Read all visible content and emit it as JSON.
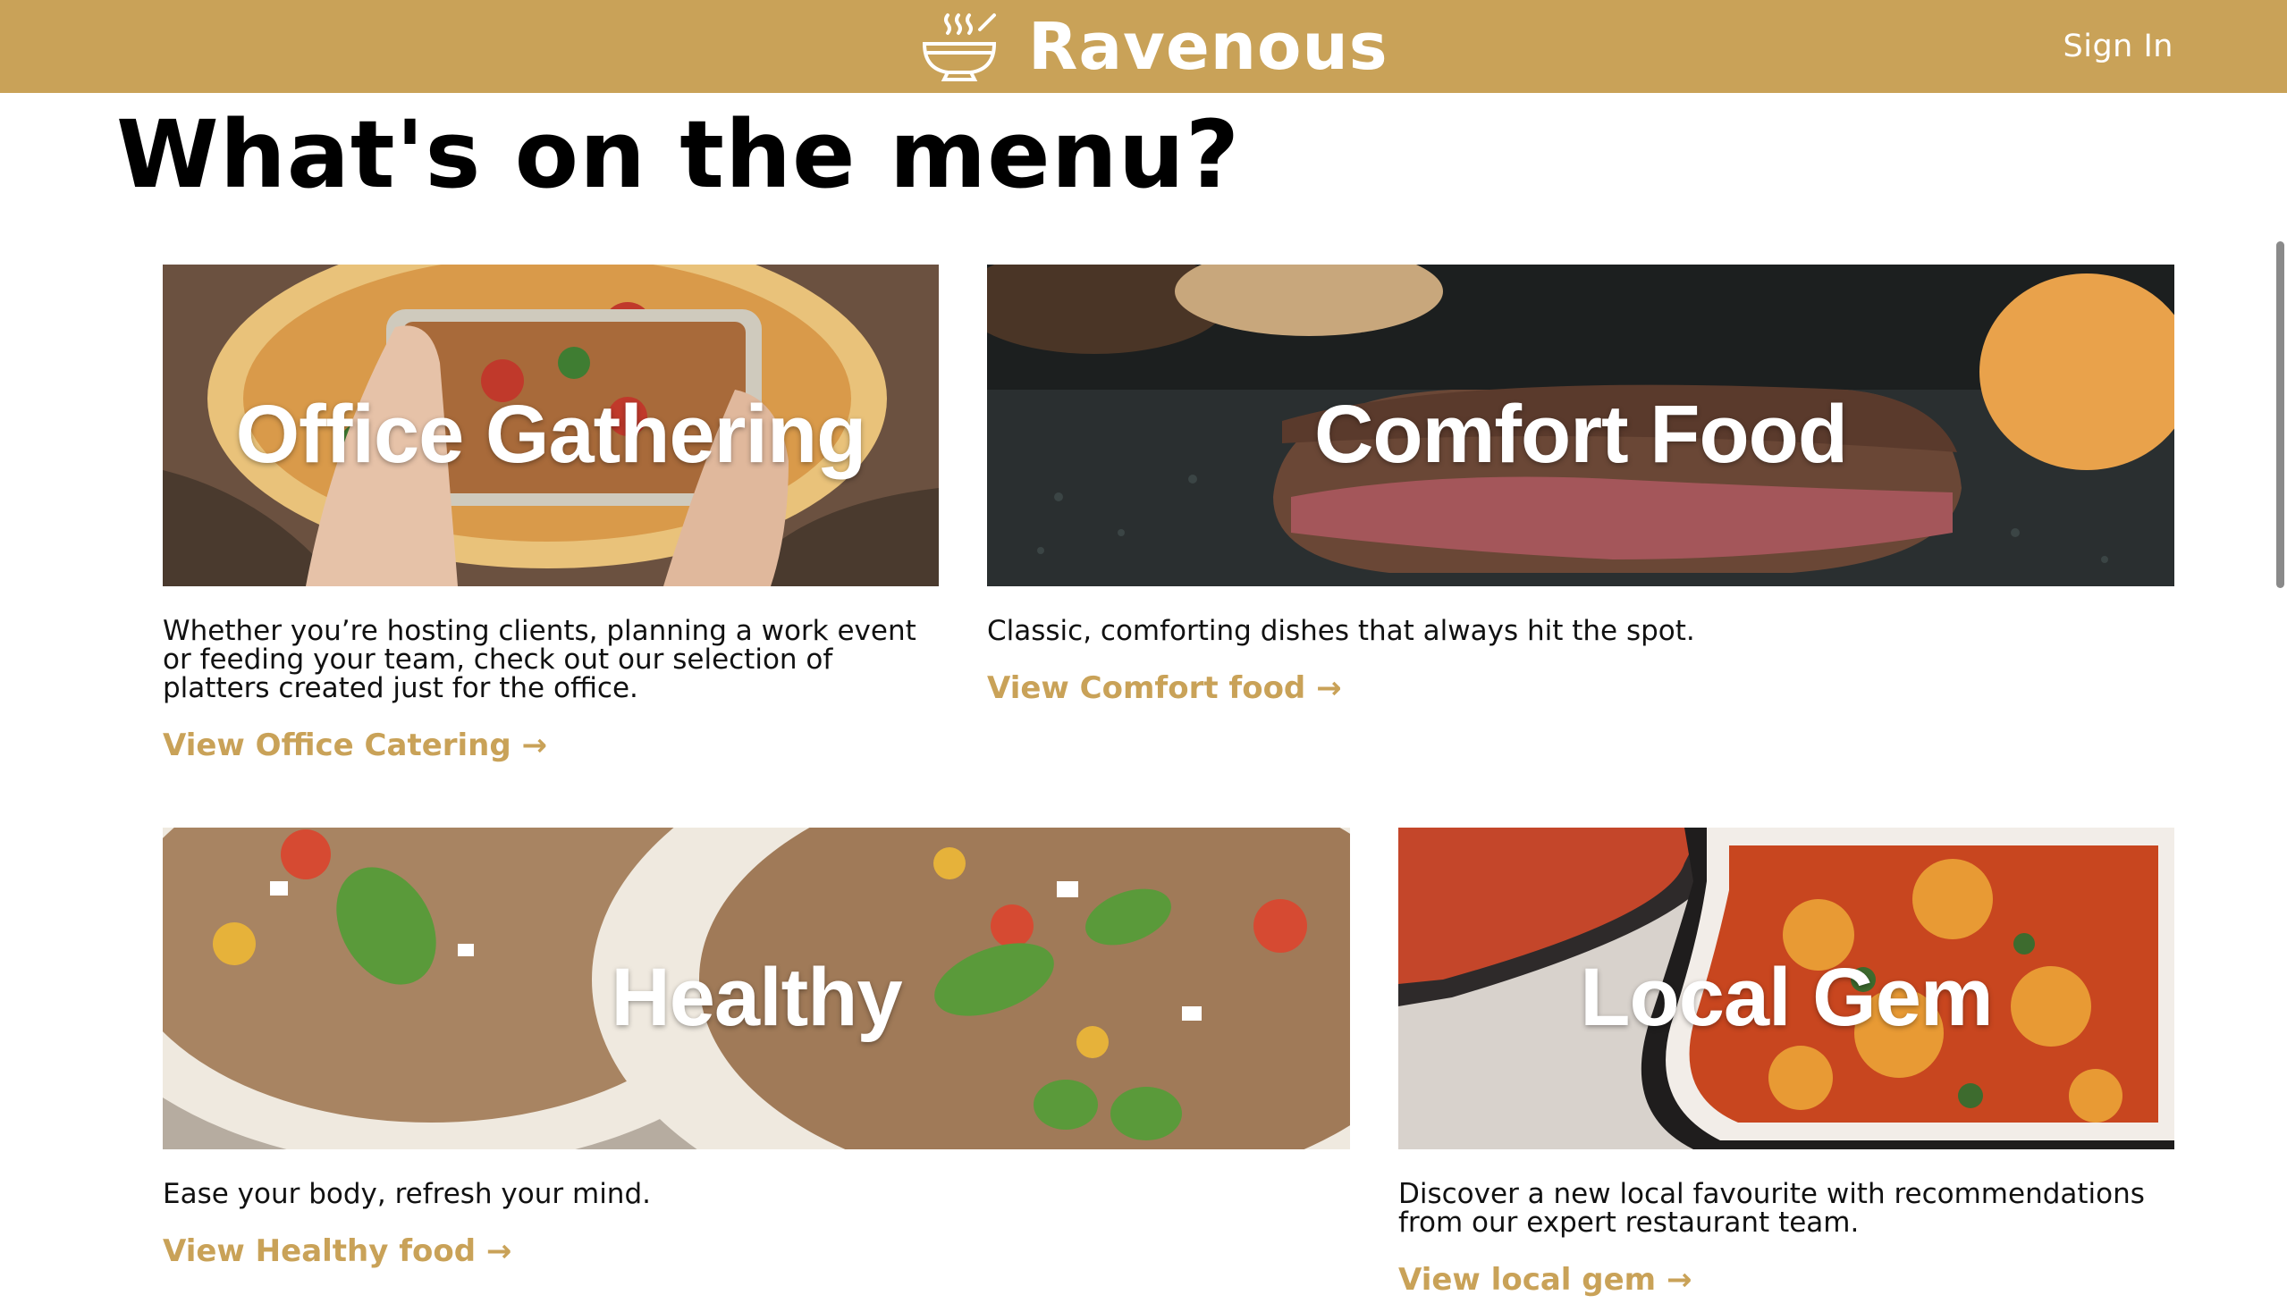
{
  "header": {
    "brand_name": "Ravenous",
    "logo_icon": "soup-bowl-icon",
    "sign_in_label": "Sign In",
    "background_color": "#c9a258"
  },
  "page": {
    "title": "What's on the menu?"
  },
  "cards": [
    {
      "image_title": "Office Gathering",
      "image_subject": "hands photographing a pizza with a phone",
      "description": "Whether you’re hosting clients, planning a work event or feeding your team, check out our selection of platters created just for the office.",
      "link_label": "View Office Catering →"
    },
    {
      "image_title": "Comfort Food",
      "image_subject": "burger patty searing on a griddle",
      "description": "Classic, comforting dishes that always hit the spot.",
      "link_label": "View Comfort food →"
    },
    {
      "image_title": "Healthy",
      "image_subject": "quinoa salad bowls with basil and tomatoes",
      "description": "Ease your body, refresh your mind.",
      "link_label": "View Healthy food →"
    },
    {
      "image_title": "Local Gem",
      "image_subject": "ravioli in tomato sauce in baking dishes",
      "description": "Discover a new local favourite with recommendations from our expert restaurant team.",
      "link_label": "View local gem →"
    }
  ],
  "theme": {
    "accent": "#c9a258",
    "text": "#111111"
  }
}
